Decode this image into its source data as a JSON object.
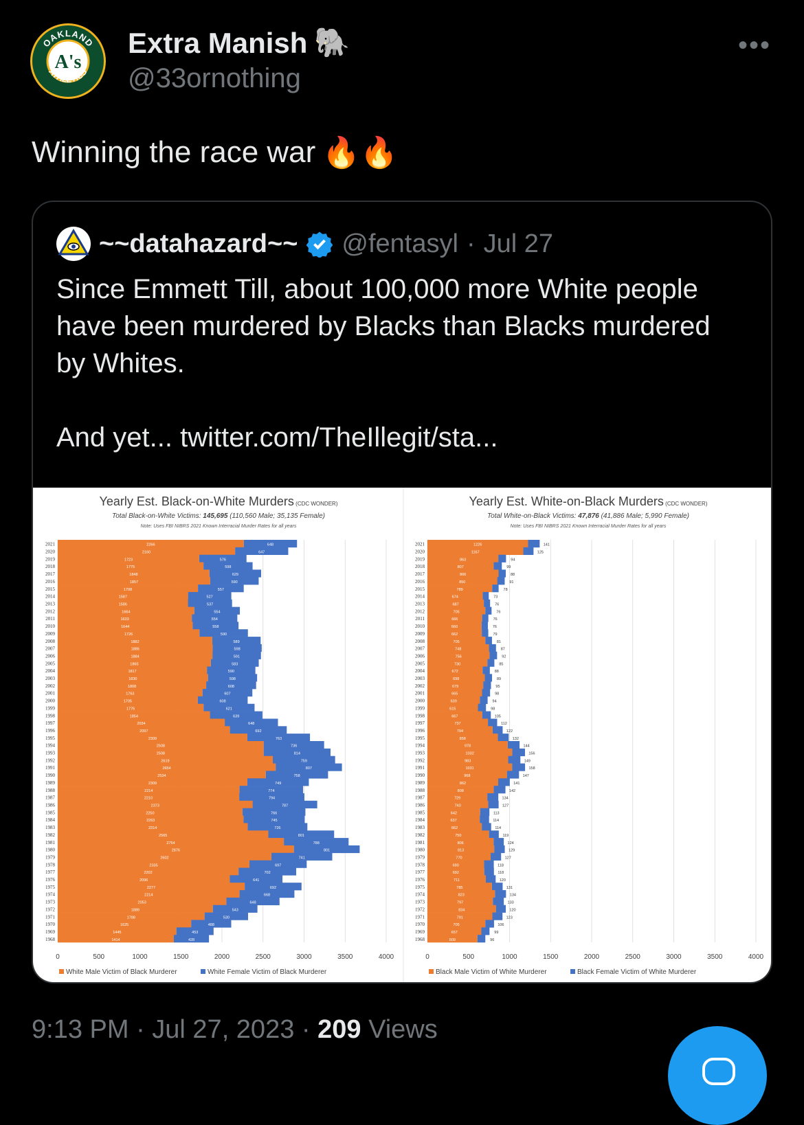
{
  "tweet": {
    "author_name": "Extra Manish",
    "author_emoji": "🐘",
    "handle": "@33ornothing",
    "more_label": "•••",
    "text": "Winning the race war",
    "text_emojis": "🔥🔥",
    "timestamp": "9:13 PM · Jul 27, 2023 · ",
    "views_count": "209",
    "views_label": " Views",
    "avatar_text_top": "OAKLAND",
    "avatar_text_bottom": "ATHLETICS",
    "avatar_monogram": "A's"
  },
  "quote": {
    "author_name": "~~datahazard~~",
    "handle": "@fentasyl",
    "separator": "·",
    "date": "Jul 27",
    "paragraph1": "Since Emmett Till, about 100,000 more White people have been murdered by Blacks than Blacks murdered by Whites.",
    "paragraph2": "And yet...  twitter.com/TheIllegit/sta..."
  },
  "colors": {
    "male": "#ed7d31",
    "female": "#4472c4",
    "accent": "#1d9bf0"
  },
  "chart_data": [
    {
      "type": "bar",
      "orientation": "horizontal",
      "stacked": true,
      "title": "Yearly Est. Black-on-White Murders",
      "title_source": "(CDC WONDER)",
      "subtitle_prefix": "Total Black-on-White Victims: ",
      "subtitle_total": "145,695",
      "subtitle_detail": " (110,560 Male; 35,135 Female)",
      "note": "Note: Uses FBI NIBRS 2021 Known Interracial Murder Rates for all years",
      "xlim": [
        0,
        4000
      ],
      "xticks": [
        "0",
        "500",
        "1000",
        "1500",
        "2000",
        "2500",
        "3000",
        "3500",
        "4000"
      ],
      "grid": true,
      "legend_position": "bottom",
      "categories": [
        "2021",
        "2020",
        "2019",
        "2018",
        "2017",
        "2016",
        "2015",
        "2014",
        "2013",
        "2012",
        "2011",
        "2010",
        "2009",
        "2008",
        "2007",
        "2006",
        "2005",
        "2004",
        "2003",
        "2002",
        "2001",
        "2000",
        "1999",
        "1998",
        "1997",
        "1996",
        "1995",
        "1994",
        "1993",
        "1992",
        "1991",
        "1990",
        "1989",
        "1988",
        "1987",
        "1986",
        "1985",
        "1984",
        "1983",
        "1982",
        "1981",
        "1980",
        "1979",
        "1978",
        "1977",
        "1976",
        "1975",
        "1974",
        "1973",
        "1972",
        "1971",
        "1970",
        "1969",
        "1968"
      ],
      "series": [
        {
          "name": "White Male Victim of Black Murderer",
          "values": [
            2266,
            2160,
            1723,
            1775,
            1848,
            1857,
            1708,
            1587,
            1586,
            1664,
            1633,
            1644,
            1726,
            1882,
            1886,
            1884,
            1865,
            1817,
            1830,
            1808,
            1763,
            1705,
            1776,
            1854,
            2034,
            2097,
            2309,
            2508,
            2508,
            2619,
            2654,
            2534,
            2309,
            2214,
            2210,
            2373,
            2250,
            2263,
            2314,
            2565,
            2754,
            2876,
            2602,
            2335,
            2202,
            2096,
            2277,
            2214,
            2053,
            1889,
            1788,
            1625,
            1445,
            1414
          ]
        },
        {
          "name": "White Female Victim of Black Murderer",
          "values": [
            648,
            647,
            576,
            598,
            629,
            590,
            557,
            527,
            537,
            554,
            554,
            558,
            590,
            589,
            598,
            591,
            583,
            590,
            598,
            608,
            607,
            608,
            621,
            639,
            648,
            692,
            763,
            736,
            814,
            759,
            807,
            758,
            749,
            774,
            794,
            787,
            766,
            745,
            726,
            801,
            788,
            801,
            741,
            697,
            702,
            641,
            692,
            668,
            648,
            543,
            530,
            488,
            453,
            428
          ]
        }
      ]
    },
    {
      "type": "bar",
      "orientation": "horizontal",
      "stacked": true,
      "title": "Yearly Est. White-on-Black Murders",
      "title_source": "(CDC WONDER)",
      "subtitle_prefix": "Total White-on-Black Victims: ",
      "subtitle_total": "47,876",
      "subtitle_detail": " (41,886 Male; 5,990 Female)",
      "note": "Note: Uses FBI NIBRS 2021 Known Interracial Murder Rates for all years",
      "xlim": [
        0,
        4000
      ],
      "xticks": [
        "0",
        "500",
        "1000",
        "1500",
        "2000",
        "2500",
        "3000",
        "3500",
        "4000"
      ],
      "grid": true,
      "legend_position": "bottom",
      "categories": [
        "2021",
        "2020",
        "2019",
        "2018",
        "2017",
        "2016",
        "2015",
        "2014",
        "2013",
        "2012",
        "2011",
        "2010",
        "2009",
        "2008",
        "2007",
        "2006",
        "2005",
        "2004",
        "2003",
        "2002",
        "2001",
        "2000",
        "1999",
        "1998",
        "1997",
        "1996",
        "1995",
        "1994",
        "1993",
        "1992",
        "1991",
        "1990",
        "1989",
        "1988",
        "1987",
        "1986",
        "1985",
        "1984",
        "1983",
        "1982",
        "1981",
        "1980",
        "1979",
        "1978",
        "1977",
        "1976",
        "1975",
        "1974",
        "1973",
        "1972",
        "1971",
        "1970",
        "1969",
        "1968"
      ],
      "series": [
        {
          "name": "Black Male Victim of White Murderer",
          "values": [
            1226,
            1167,
            863,
            807,
            866,
            850,
            789,
            674,
            687,
            705,
            666,
            660,
            662,
            705,
            748,
            756,
            730,
            672,
            698,
            679,
            665,
            639,
            615,
            667,
            737,
            794,
            858,
            978,
            1032,
            983,
            1031,
            968,
            862,
            808,
            729,
            740,
            642,
            637,
            662,
            750,
            806,
            813,
            770,
            690,
            692,
            711,
            785,
            823,
            797,
            834,
            791,
            705,
            657,
            609
          ]
        },
        {
          "name": "Black Female Victim of White Murderer",
          "values": [
            141,
            125,
            94,
            99,
            88,
            91,
            78,
            73,
            76,
            76,
            76,
            76,
            79,
            81,
            87,
            92,
            85,
            88,
            89,
            95,
            98,
            94,
            98,
            105,
            112,
            122,
            132,
            144,
            156,
            149,
            158,
            147,
            141,
            142,
            134,
            127,
            113,
            114,
            114,
            119,
            124,
            129,
            127,
            118,
            118,
            120,
            131,
            134,
            133,
            120,
            123,
            106,
            99,
            96
          ]
        }
      ]
    }
  ]
}
